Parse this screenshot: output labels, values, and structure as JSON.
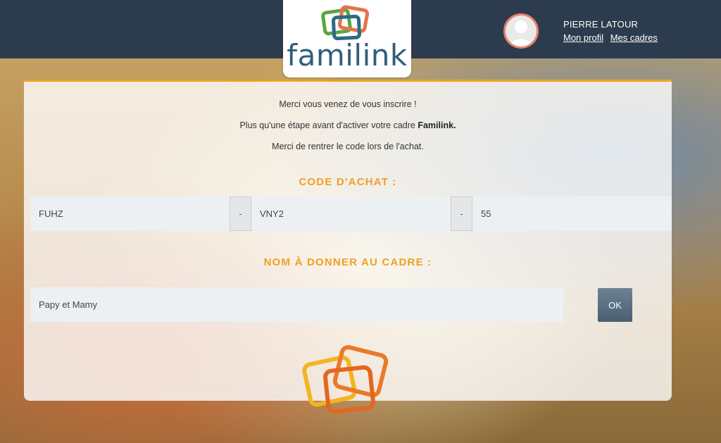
{
  "header": {
    "brand": "familink",
    "logo_icon": "familink-frames-logo",
    "user": {
      "name": "PIERRE LATOUR",
      "avatar_icon": "user-avatar-icon",
      "links": [
        "Mon profil",
        "Mes cadres"
      ]
    }
  },
  "main": {
    "messages": {
      "line1": "Merci vous venez de vous inscrire !",
      "line2_prefix": "Plus qu'une étape avant d'activer votre cadre ",
      "line2_brand": "Familink.",
      "line3": "Merci de rentrer le code lors de l'achat."
    },
    "code_section": {
      "title": "CODE D'ACHAT :",
      "fields": [
        "FUHZ",
        "VNY2",
        "55"
      ],
      "separator": "-"
    },
    "name_section": {
      "title": "NOM À DONNER AU CADRE :",
      "value": "Papy et Mamy",
      "submit_label": "OK"
    }
  },
  "colors": {
    "header_bg": "#2d3b4e",
    "accent": "#f0a020",
    "brand_text": "#2f5f7a",
    "button_bg": "#56697a"
  }
}
